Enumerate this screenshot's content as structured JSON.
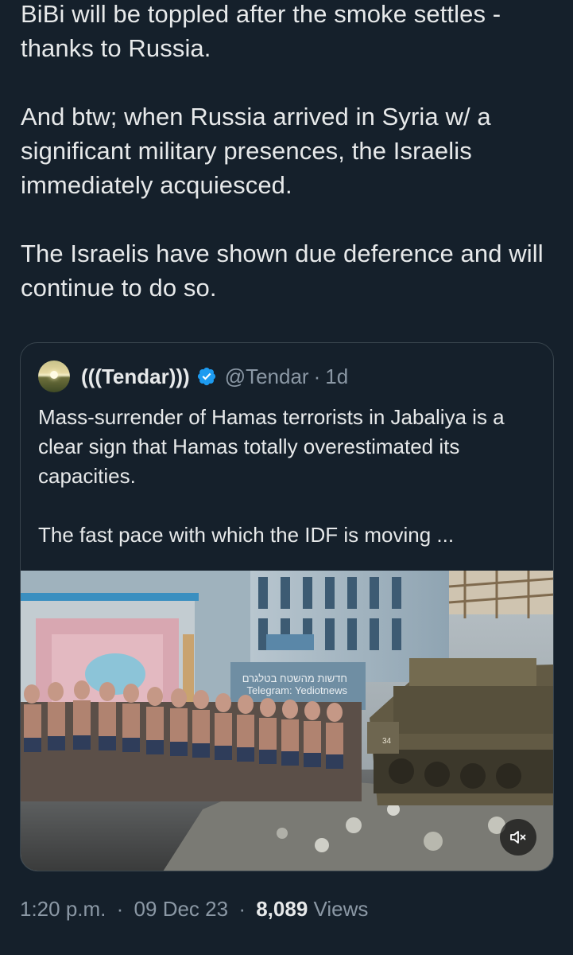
{
  "tweet": {
    "paragraphs": [
      "BiBi will be toppled after the smoke settles - thanks to Russia.",
      "And btw; when Russia arrived in Syria w/ a significant military presences, the Israelis immediately acquiesced.",
      "The Israelis have shown due deference and will continue to do so."
    ]
  },
  "quote": {
    "display_name": "(((Tendar)))",
    "handle": "@Tendar",
    "separator": "·",
    "time": "1d",
    "verified": true,
    "paragraphs": [
      "Mass-surrender of Hamas terrorists in Jabaliya is a clear sign that Hamas totally overestimated its capacities.",
      "The fast pace with which the IDF is moving ..."
    ],
    "media": {
      "watermark_line1": "חדשות מהשטח בטלגרם",
      "watermark_line2": "Telegram: Yediotnews",
      "vehicle_number": "34",
      "mute_icon": "speaker-muted-icon"
    }
  },
  "meta": {
    "time": "1:20 p.m.",
    "sep1": "·",
    "date": "09 Dec 23",
    "sep2": "·",
    "views_count": "8,089",
    "views_label": "Views"
  },
  "colors": {
    "background": "#15202b",
    "text": "#e7e9ea",
    "secondary_text": "#8b98a5",
    "border": "#38444d",
    "verified_badge": "#1d9bf0"
  }
}
